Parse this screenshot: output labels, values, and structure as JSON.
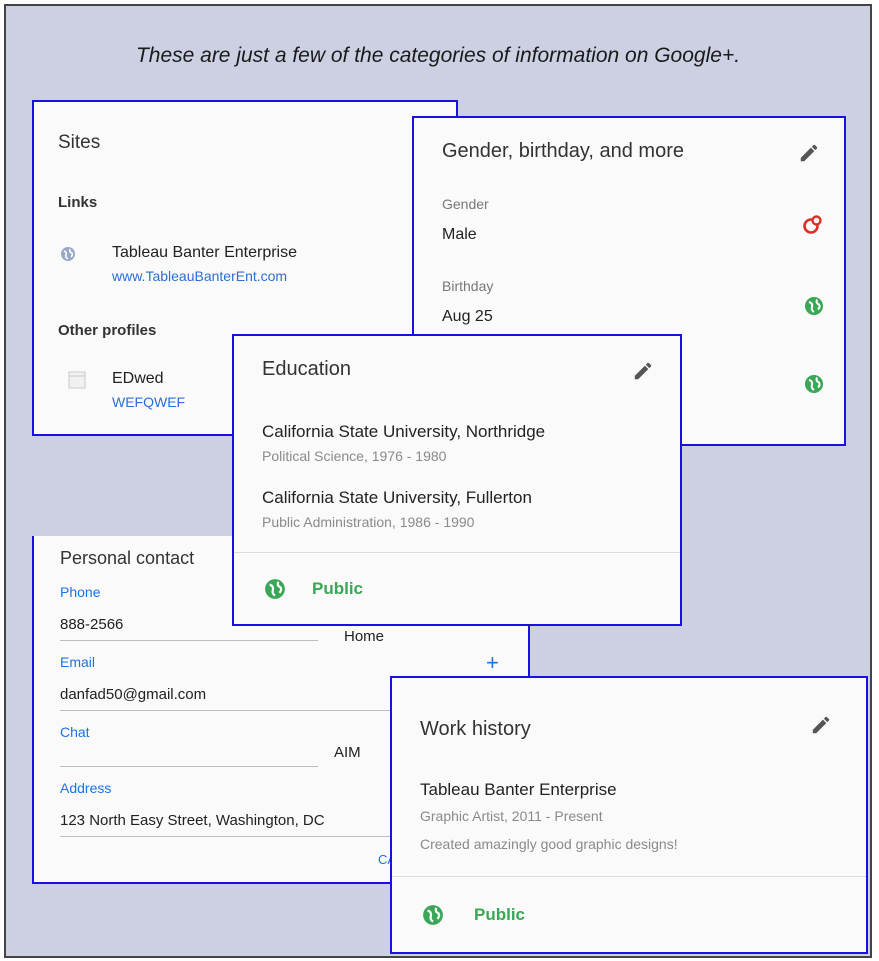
{
  "caption": "These are just a few of the categories of information on Google+.",
  "sites": {
    "title": "Sites",
    "links_heading": "Links",
    "link_name": "Tableau Banter Enterprise",
    "link_url": "www.TableauBanterEnt.com",
    "other_heading": "Other profiles",
    "profile_name": "EDwed",
    "profile_link": "WEFQWEF"
  },
  "gender_card": {
    "title": "Gender, birthday, and more",
    "gender_label": "Gender",
    "gender_value": "Male",
    "birthday_label": "Birthday",
    "birthday_value": "Aug 25"
  },
  "education": {
    "title": "Education",
    "entries": [
      {
        "school": "California State University, Northridge",
        "detail": "Political Science, 1976 - 1980"
      },
      {
        "school": "California State University, Fullerton",
        "detail": "Public Administration, 1986 - 1990"
      }
    ],
    "visibility": "Public"
  },
  "contact": {
    "title": "Personal contact",
    "phone_label": "Phone",
    "phone_value": "888-2566",
    "phone_type": "Home",
    "email_label": "Email",
    "email_value": "danfad50@gmail.com",
    "add_symbol": "+",
    "chat_label": "Chat",
    "chat_type": "AIM",
    "address_label": "Address",
    "address_value": "123 North Easy Street, Washington, DC",
    "cancel_partial": "CA"
  },
  "work": {
    "title": "Work history",
    "company": "Tableau Banter Enterprise",
    "role": "Graphic Artist, 2011 - Present",
    "description": "Created amazingly good graphic designs!",
    "visibility": "Public"
  },
  "colors": {
    "card_border": "#1a10e6",
    "background": "#ccd0e2",
    "public_green": "#3aa757",
    "extended_circles_red": "#d93025",
    "link_blue": "#2a6fd6"
  },
  "icons": [
    "pencil-icon",
    "globe-icon",
    "extended-circles-icon",
    "document-icon",
    "plus-icon"
  ]
}
